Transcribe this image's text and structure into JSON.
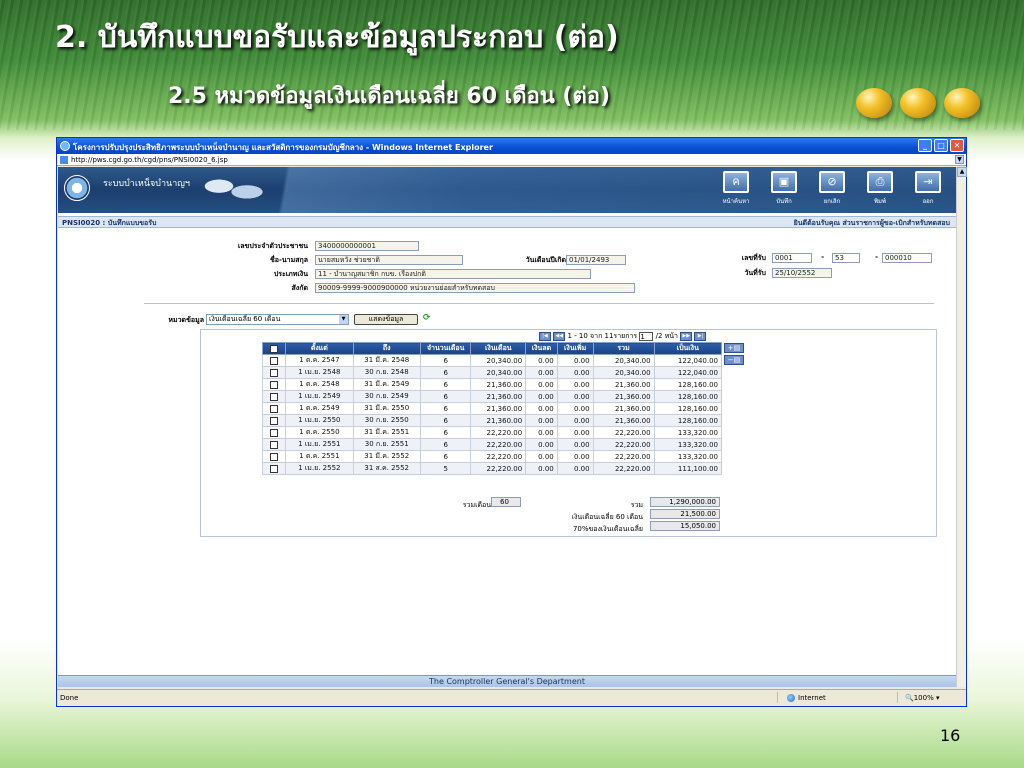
{
  "slide": {
    "title": "2. บันทึกแบบขอรับและข้อมูลประกอบ (ต่อ)",
    "subtitle": "2.5 หมวดข้อมูลเงินเดือนเฉลี่ย 60 เดือน (ต่อ)",
    "page_number": "16"
  },
  "browser": {
    "title": "โครงการปรับปรุงประสิทธิภาพระบบบำเหน็จบำนาญ และสวัสดิการของกรมบัญชีกลาง - Windows Internet Explorer",
    "address": "http://pws.cgd.go.th/cgd/pns/PNSI0020_6.jsp",
    "status": "Done",
    "zone": "Internet",
    "zoom": "100%"
  },
  "app": {
    "name": "ระบบบำเหน็จบำนาญฯ",
    "toolbar": [
      {
        "icon": "ค",
        "label": "หน้าค้นหา"
      },
      {
        "icon": "▣",
        "label": "บันทึก"
      },
      {
        "icon": "⊘",
        "label": "ยกเลิก"
      },
      {
        "icon": "⎙",
        "label": "พิมพ์"
      },
      {
        "icon": "⇥",
        "label": "ออก"
      }
    ],
    "form_title": "PNSI0020 : บันทึกแบบขอรับ",
    "welcome": "ยินดีต้อนรับคุณ ส่วนราชการผู้ขอ-เบิกสำหรับทดสอบ",
    "footer": "The Comptroller General's Department"
  },
  "form": {
    "id_label": "เลขประจำตัวประชาชน",
    "id_value": "3400000000001",
    "name_label": "ชื่อ-นามสกุล",
    "name_value": "นายสมหวัง ช่วยชาติ",
    "birth_label": "วันเดือนปีเกิด",
    "birth_value": "01/01/2493",
    "type_label": "ประเภทเงิน",
    "type_value": "11 - บำนาญสมาชิก กบข. เรื่องปกติ",
    "unit_label": "สังกัด",
    "unit_value": "90009-9999-9000900000  หน่วยงานย่อยสำหรับทดสอบ",
    "recv_no_label": "เลขที่รับ",
    "recv_no_1": "0001",
    "recv_no_2": "53",
    "recv_no_3": "000010",
    "dash": "-",
    "recv_date_label": "วันที่รับ",
    "recv_date_value": "25/10/2552",
    "category_label": "หมวดข้อมูล",
    "category_value": "เงินเดือนเฉลี่ย 60 เดือน",
    "show_button": "แสดงข้อมูล"
  },
  "pager": {
    "text": "1 - 10 จาก 11รายการ",
    "page": "1",
    "total": "/2 หน้า"
  },
  "table": {
    "headers": [
      "ตั้งแต่",
      "ถึง",
      "จำนวนเดือน",
      "เงินเดือน",
      "เงินลด",
      "เงินเพิ่ม",
      "รวม",
      "เป็นเงิน"
    ],
    "rows": [
      [
        "1 ต.ค. 2547",
        "31 มี.ค. 2548",
        "6",
        "20,340.00",
        "0.00",
        "0.00",
        "20,340.00",
        "122,040.00"
      ],
      [
        "1 เม.ย. 2548",
        "30 ก.ย. 2548",
        "6",
        "20,340.00",
        "0.00",
        "0.00",
        "20,340.00",
        "122,040.00"
      ],
      [
        "1 ต.ค. 2548",
        "31 มี.ค. 2549",
        "6",
        "21,360.00",
        "0.00",
        "0.00",
        "21,360.00",
        "128,160.00"
      ],
      [
        "1 เม.ย. 2549",
        "30 ก.ย. 2549",
        "6",
        "21,360.00",
        "0.00",
        "0.00",
        "21,360.00",
        "128,160.00"
      ],
      [
        "1 ต.ค. 2549",
        "31 มี.ค. 2550",
        "6",
        "21,360.00",
        "0.00",
        "0.00",
        "21,360.00",
        "128,160.00"
      ],
      [
        "1 เม.ย. 2550",
        "30 ก.ย. 2550",
        "6",
        "21,360.00",
        "0.00",
        "0.00",
        "21,360.00",
        "128,160.00"
      ],
      [
        "1 ต.ค. 2550",
        "31 มี.ค. 2551",
        "6",
        "22,220.00",
        "0.00",
        "0.00",
        "22,220.00",
        "133,320.00"
      ],
      [
        "1 เม.ย. 2551",
        "30 ก.ย. 2551",
        "6",
        "22,220.00",
        "0.00",
        "0.00",
        "22,220.00",
        "133,320.00"
      ],
      [
        "1 ต.ค. 2551",
        "31 มี.ค. 2552",
        "6",
        "22,220.00",
        "0.00",
        "0.00",
        "22,220.00",
        "133,320.00"
      ],
      [
        "1 เม.ย. 2552",
        "31 ส.ค. 2552",
        "5",
        "22,220.00",
        "0.00",
        "0.00",
        "22,220.00",
        "111,100.00"
      ]
    ]
  },
  "summary": {
    "months_label": "รวมเดือน",
    "months_value": "60",
    "total_label": "รวม",
    "total_value": "1,290,000.00",
    "avg_label": "เงินเดือนเฉลี่ย 60 เดือน",
    "avg_value": "21,500.00",
    "pct_label": "70%ของเงินเดือนเฉลี่ย",
    "pct_value": "15,050.00"
  }
}
